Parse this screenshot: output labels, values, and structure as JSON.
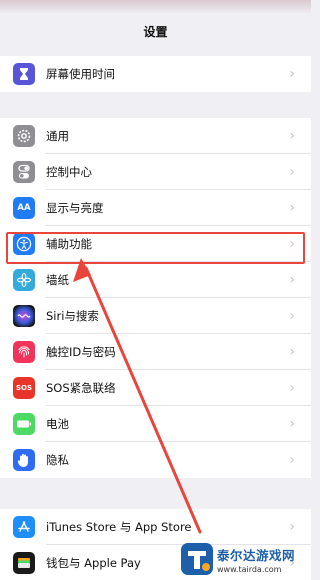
{
  "nav": {
    "title": "设置"
  },
  "group1": [
    {
      "label": "屏幕使用时间",
      "icon": "hourglass-icon",
      "color": "#5856d6"
    }
  ],
  "group2": [
    {
      "label": "通用",
      "icon": "gear-icon",
      "color": "#8e8e93"
    },
    {
      "label": "控制中心",
      "icon": "toggles-icon",
      "color": "#8e8e93"
    },
    {
      "label": "显示与亮度",
      "icon": "text-size-icon",
      "color": "#1f7cf2",
      "icon_text": "AA"
    },
    {
      "label": "辅助功能",
      "icon": "accessibility-icon",
      "color": "#1f7cf2"
    },
    {
      "label": "墙纸",
      "icon": "flower-icon",
      "color": "#34aadc"
    },
    {
      "label": "Siri与搜索",
      "icon": "siri-icon",
      "color": "#222222"
    },
    {
      "label": "触控ID与密码",
      "icon": "fingerprint-icon",
      "color": "#f2335c"
    },
    {
      "label": "SOS紧急联络",
      "icon": "sos-icon",
      "color": "#e8352b",
      "icon_text": "SOS"
    },
    {
      "label": "电池",
      "icon": "battery-icon",
      "color": "#4cd964"
    },
    {
      "label": "隐私",
      "icon": "hand-icon",
      "color": "#2f6cf0"
    }
  ],
  "group3": [
    {
      "label": "iTunes Store 与 App Store",
      "icon": "app-store-icon",
      "color": "#1e8ef8"
    },
    {
      "label": "钱包与 Apple Pay",
      "icon": "wallet-icon",
      "color": "#1a1a1a"
    }
  ],
  "chevron": "›",
  "highlight_color": "#e8453c",
  "watermark": {
    "name": "泰尔达游戏网",
    "url": "www.tairda.com"
  }
}
